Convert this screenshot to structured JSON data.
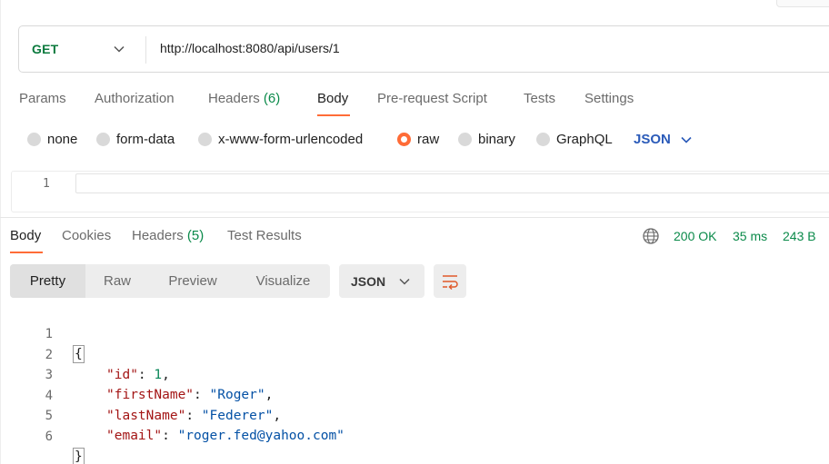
{
  "request": {
    "method": "GET",
    "url": "http://localhost:8080/api/users/1"
  },
  "request_tabs": [
    {
      "label": "Params",
      "count": ""
    },
    {
      "label": "Authorization",
      "count": ""
    },
    {
      "label": "Headers",
      "count": "(6)"
    },
    {
      "label": "Body",
      "count": "",
      "active": true
    },
    {
      "label": "Pre-request Script",
      "count": ""
    },
    {
      "label": "Tests",
      "count": ""
    },
    {
      "label": "Settings",
      "count": ""
    }
  ],
  "body_types": [
    {
      "label": "none",
      "selected": false
    },
    {
      "label": "form-data",
      "selected": false
    },
    {
      "label": "x-www-form-urlencoded",
      "selected": false
    },
    {
      "label": "raw",
      "selected": true
    },
    {
      "label": "binary",
      "selected": false
    },
    {
      "label": "GraphQL",
      "selected": false
    }
  ],
  "body_format": "JSON",
  "request_editor": {
    "line_numbers": [
      "1"
    ]
  },
  "response_tabs": [
    {
      "label": "Body",
      "count": "",
      "active": true
    },
    {
      "label": "Cookies",
      "count": ""
    },
    {
      "label": "Headers",
      "count": "(5)"
    },
    {
      "label": "Test Results",
      "count": ""
    }
  ],
  "response_status": {
    "status": "200 OK",
    "time": "35 ms",
    "size": "243 B"
  },
  "view_modes": [
    {
      "label": "Pretty",
      "active": true
    },
    {
      "label": "Raw"
    },
    {
      "label": "Preview"
    },
    {
      "label": "Visualize"
    }
  ],
  "response_format": "JSON",
  "response_body": {
    "line_numbers": [
      "1",
      "2",
      "3",
      "4",
      "5",
      "6"
    ],
    "open_brace": "{",
    "close_brace": "}",
    "fields": [
      {
        "key": "\"id\"",
        "value": "1",
        "type": "number",
        "comma": ","
      },
      {
        "key": "\"firstName\"",
        "value": "\"Roger\"",
        "type": "string",
        "comma": ","
      },
      {
        "key": "\"lastName\"",
        "value": "\"Federer\"",
        "type": "string",
        "comma": ","
      },
      {
        "key": "\"email\"",
        "value": "\"roger.fed@yahoo.com\"",
        "type": "string",
        "comma": ""
      }
    ]
  },
  "icons": {
    "method_dropdown": "chevron-down-icon",
    "format_dropdown": "chevron-down-icon",
    "globe": "globe-icon",
    "wrap": "wrap-lines-icon"
  },
  "colors": {
    "accent": "#ff6c37",
    "method_get": "#0b7a3e",
    "status_ok": "#0b8a4a",
    "link_blue": "#2b5bb9"
  }
}
